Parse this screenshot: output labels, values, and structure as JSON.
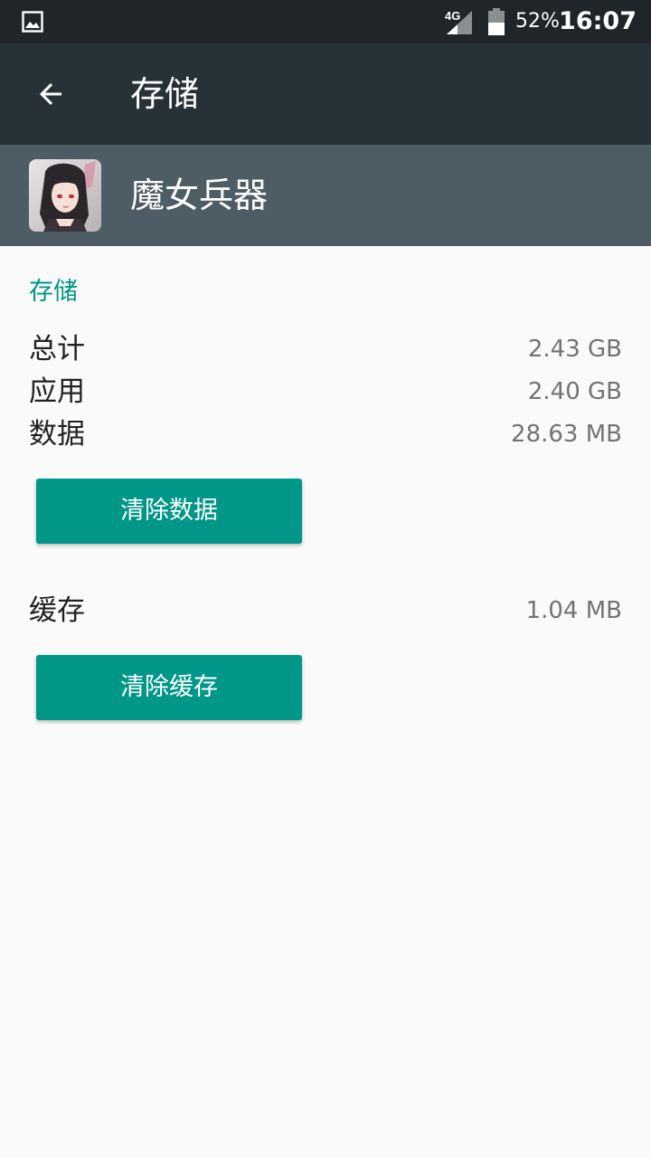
{
  "status_bar": {
    "network_type": "4G",
    "battery": "52%",
    "time": "16:07",
    "icons": [
      "gallery-icon",
      "signal-icon",
      "battery-icon"
    ]
  },
  "toolbar": {
    "title": "存储",
    "back_icon": "arrow-back-icon"
  },
  "app": {
    "name": "魔女兵器",
    "icon": "app-icon-anime-girl"
  },
  "storage": {
    "header": "存储",
    "rows": [
      {
        "label": "总计",
        "value": "2.43 GB"
      },
      {
        "label": "应用",
        "value": "2.40 GB"
      },
      {
        "label": "数据",
        "value": "28.63 MB"
      }
    ],
    "clear_data_label": "清除数据"
  },
  "cache": {
    "label": "缓存",
    "value": "1.04 MB",
    "clear_cache_label": "清除缓存"
  },
  "colors": {
    "status_bar": "#1f2528",
    "toolbar": "#263238",
    "app_header": "#4e5d65",
    "accent": "#009688",
    "background": "#fafafa"
  }
}
